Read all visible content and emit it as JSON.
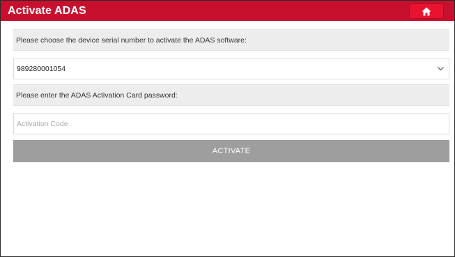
{
  "header": {
    "title": "Activate ADAS",
    "home_icon": "home-icon",
    "background_color": "#c8102e"
  },
  "serial_section": {
    "prompt": "Please choose the device serial number to activate the ADAS software:",
    "selected_serial": "989280001054",
    "dropdown_icon": "chevron-down-icon"
  },
  "password_section": {
    "prompt": "Please enter the ADAS Activation Card password:",
    "placeholder": "Activation Code",
    "value": ""
  },
  "actions": {
    "activate_label": "ACTIVATE",
    "activate_color": "#9e9e9e"
  }
}
